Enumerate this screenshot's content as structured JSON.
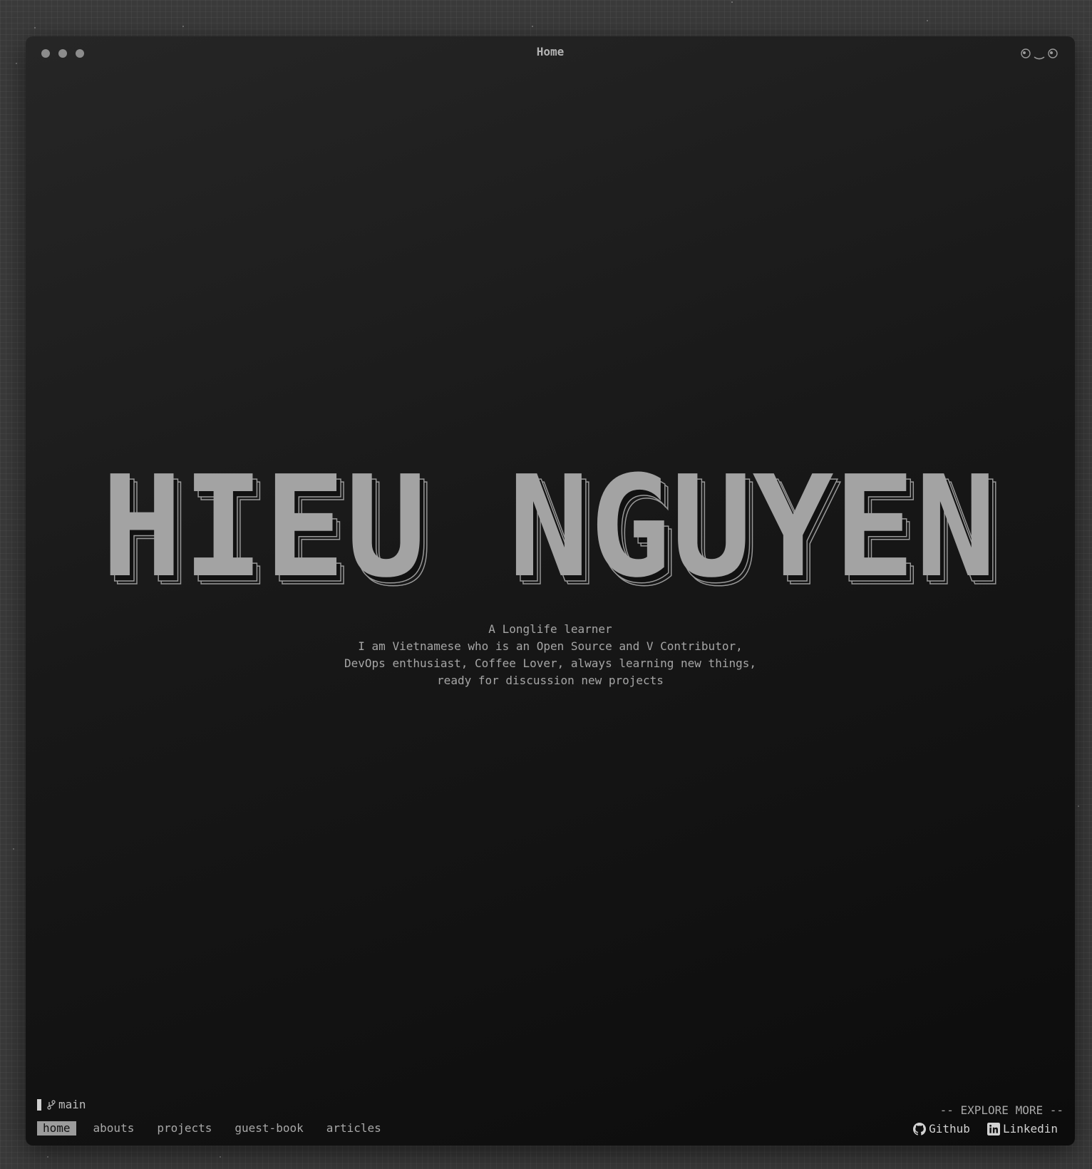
{
  "window": {
    "title": "Home"
  },
  "hero": {
    "name": "HIEU NGUYEN",
    "tagline": [
      "A Longlife learner",
      "I am Vietnamese who is an Open Source and V Contributor,",
      "DevOps enthusiast, Coffee Lover, always learning new things,",
      "ready for discussion new projects"
    ]
  },
  "status": {
    "branch": "main",
    "explore": "-- EXPLORE MORE --"
  },
  "nav": {
    "home": "home",
    "abouts": "abouts",
    "projects": "projects",
    "guest_book": "guest-book",
    "articles": "articles"
  },
  "social": {
    "github": "Github",
    "linkedin": "Linkedin"
  },
  "colors": {
    "accent": "#9c9c9c",
    "text": "#a6a6a6",
    "background": "#141414"
  }
}
